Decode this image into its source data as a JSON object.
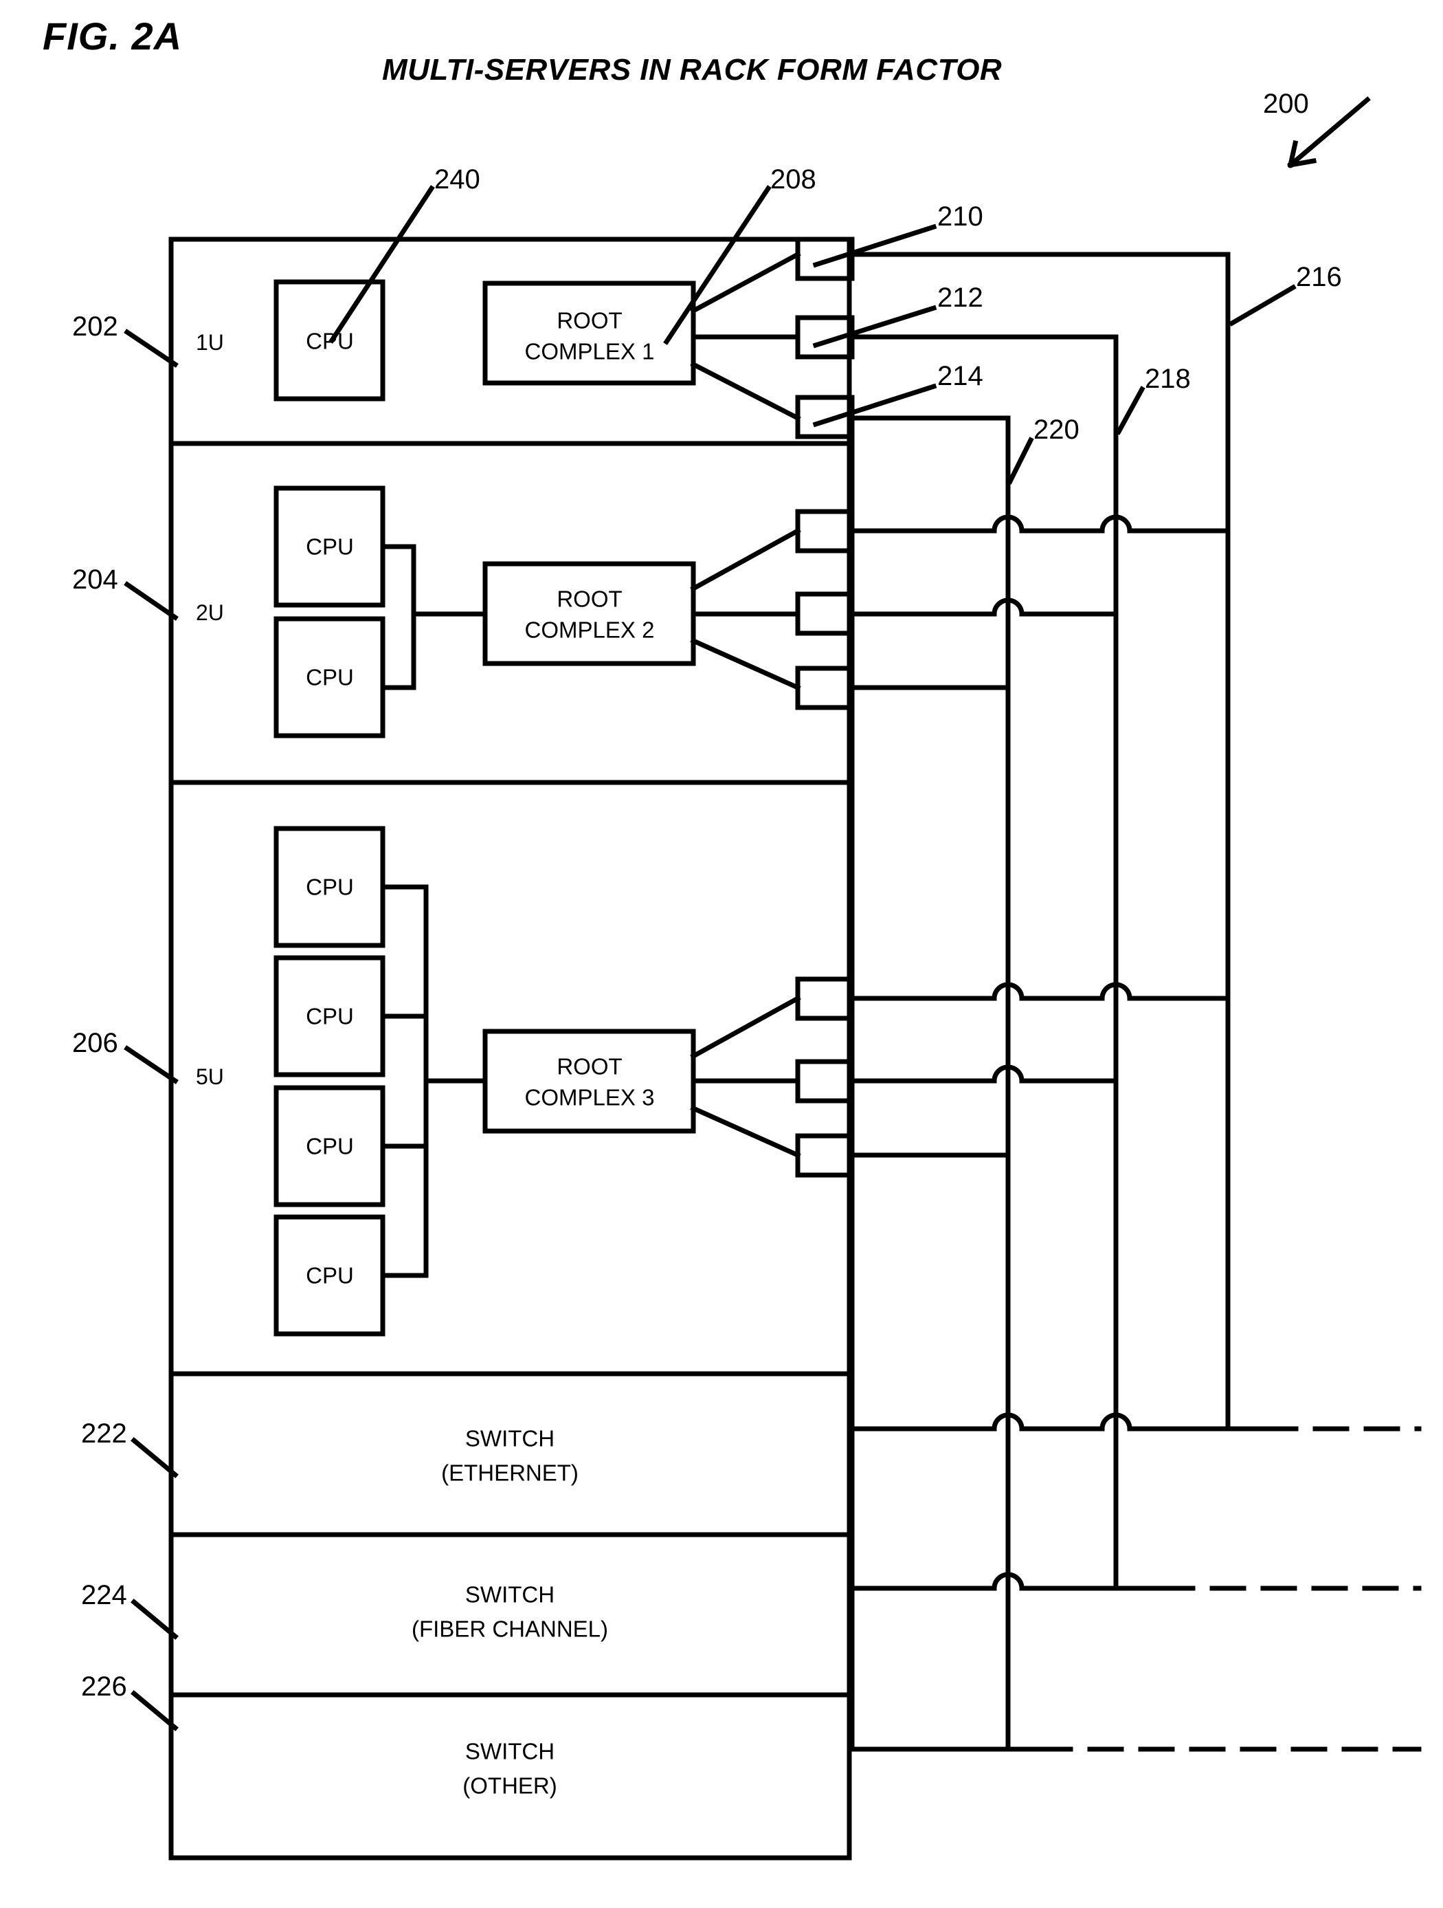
{
  "figure": {
    "number": "FIG. 2A",
    "title": "MULTI-SERVERS IN RACK FORM FACTOR",
    "system_ref": "200"
  },
  "rack": {
    "servers": [
      {
        "ref": "202",
        "unit_label": "1U",
        "cpus": [
          "CPU"
        ],
        "root_complex": "ROOT\nCOMPLEX 1",
        "root_complex_ref": "208",
        "cpu_ref": "240",
        "ports": [
          {
            "ref": "210"
          },
          {
            "ref": "212"
          },
          {
            "ref": "214"
          }
        ]
      },
      {
        "ref": "204",
        "unit_label": "2U",
        "cpus": [
          "CPU",
          "CPU"
        ],
        "root_complex": "ROOT\nCOMPLEX 2",
        "ports": [
          {},
          {},
          {}
        ]
      },
      {
        "ref": "206",
        "unit_label": "5U",
        "cpus": [
          "CPU",
          "CPU",
          "CPU",
          "CPU"
        ],
        "root_complex": "ROOT\nCOMPLEX 3",
        "ports": [
          {},
          {},
          {}
        ]
      }
    ],
    "switches": [
      {
        "ref": "222",
        "line1": "SWITCH",
        "line2": "(ETHERNET)"
      },
      {
        "ref": "224",
        "line1": "SWITCH",
        "line2": "(FIBER CHANNEL)"
      },
      {
        "ref": "226",
        "line1": "SWITCH",
        "line2": "(OTHER)"
      }
    ],
    "cable_refs": [
      "216",
      "218",
      "220"
    ]
  },
  "labels": {
    "ref_200": "200",
    "ref_202": "202",
    "ref_204": "204",
    "ref_206": "206",
    "ref_208": "208",
    "ref_210": "210",
    "ref_212": "212",
    "ref_214": "214",
    "ref_216": "216",
    "ref_218": "218",
    "ref_220": "220",
    "ref_222": "222",
    "ref_224": "224",
    "ref_226": "226",
    "ref_240": "240",
    "unit_1u": "1U",
    "unit_2u": "2U",
    "unit_5u": "5U",
    "cpu": "CPU",
    "rc1_l1": "ROOT",
    "rc1_l2": "COMPLEX 1",
    "rc2_l1": "ROOT",
    "rc2_l2": "COMPLEX 2",
    "rc3_l1": "ROOT",
    "rc3_l2": "COMPLEX 3",
    "sw_word": "SWITCH",
    "sw_eth": "(ETHERNET)",
    "sw_fc": "(FIBER CHANNEL)",
    "sw_other": "(OTHER)"
  },
  "colors": {
    "ink": "#000000",
    "paper": "#ffffff"
  }
}
